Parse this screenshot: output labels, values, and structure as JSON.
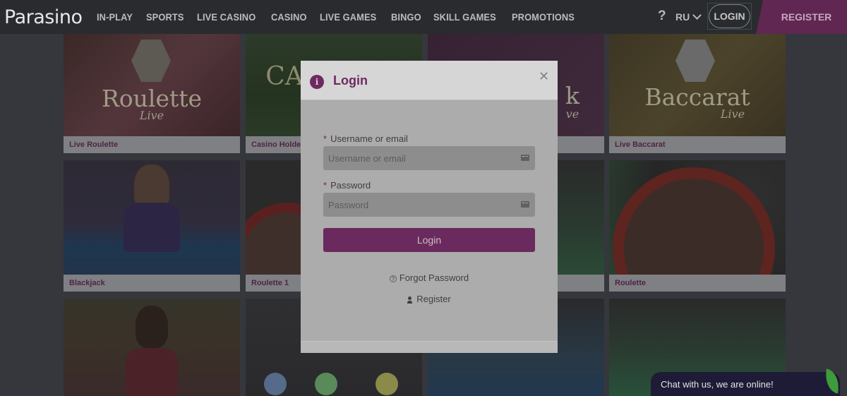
{
  "header": {
    "logo": "Parasino",
    "nav": [
      "IN-PLAY",
      "SPORTS",
      "LIVE CASINO",
      "CASINO",
      "LIVE GAMES",
      "BINGO",
      "SKILL GAMES",
      "PROMOTIONS"
    ],
    "help": "?",
    "language": "RU",
    "login_label": "LOGIN",
    "register_label": "REGISTER"
  },
  "games": [
    {
      "caption": "Live Roulette",
      "art_title": "Roulette",
      "art_sub": "Live"
    },
    {
      "caption": "Casino Holde",
      "art_title": "CA",
      "art_sub": ""
    },
    {
      "caption": "",
      "art_title": "k",
      "art_sub": "ve"
    },
    {
      "caption": "Live Baccarat",
      "art_title": "Baccarat",
      "art_sub": "Live"
    },
    {
      "caption": "Blackjack"
    },
    {
      "caption": "Roulette 1"
    },
    {
      "caption": ""
    },
    {
      "caption": "Roulette"
    }
  ],
  "modal": {
    "title": "Login",
    "username_label": "Username or email",
    "username_placeholder": "Username or email",
    "password_label": "Password",
    "password_placeholder": "Password",
    "submit_label": "Login",
    "forgot_label": "Forgot Password",
    "register_label": "Register",
    "required_marker": "*"
  },
  "chat": {
    "label": "Chat with us, we are online!"
  }
}
